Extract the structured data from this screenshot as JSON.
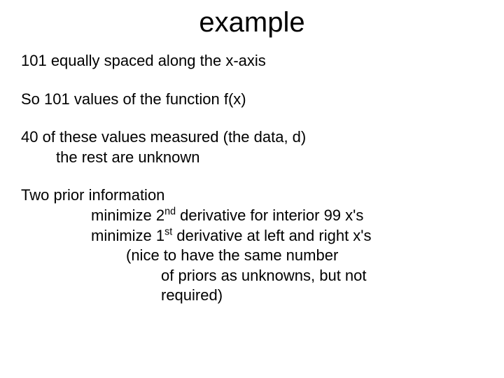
{
  "title": "example",
  "lines": {
    "l1": "101 equally spaced along the x-axis",
    "l2": "So 101 values of the function f(x)",
    "l3": "40  of these values measured (the data, d)",
    "l4": "the rest are unknown",
    "l5": "Two prior information",
    "l6_pre": "minimize 2",
    "l6_sup": "nd",
    "l6_post": " derivative for interior 99 x's",
    "l7_pre": "minimize 1",
    "l7_sup": "st",
    "l7_post": " derivative at left and right x's",
    "l8": "(nice to have the same number",
    "l9": "of priors as unknowns, but not",
    "l10": "required)"
  }
}
